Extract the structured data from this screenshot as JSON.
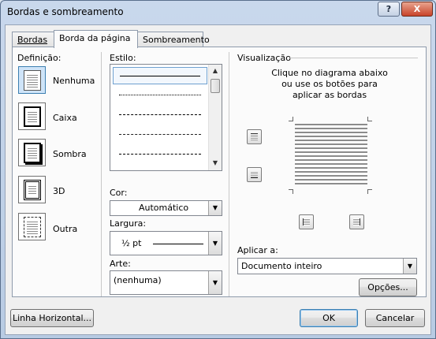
{
  "window": {
    "title": "Bordas e sombreamento",
    "help_label": "?",
    "close_label": "X"
  },
  "tabs": [
    {
      "label": "Bordas",
      "active": false
    },
    {
      "label": "Borda da página",
      "active": true
    },
    {
      "label": "Sombreamento",
      "active": false
    }
  ],
  "definition": {
    "label": "Definição:",
    "options": [
      {
        "label": "Nenhuma",
        "icon": "page-lines-icon",
        "selected": true
      },
      {
        "label": "Caixa",
        "icon": "box-border-icon",
        "selected": false
      },
      {
        "label": "Sombra",
        "icon": "shadow-border-icon",
        "selected": false
      },
      {
        "label": "3D",
        "icon": "3d-border-icon",
        "selected": false
      },
      {
        "label": "Outra",
        "icon": "custom-border-icon",
        "selected": false
      }
    ]
  },
  "style": {
    "label": "Estilo:",
    "items": [
      "solid",
      "dotted",
      "dashed-short",
      "dashed",
      "dash-dot"
    ],
    "selected_index": 0
  },
  "color": {
    "label": "Cor:",
    "value": "Automático"
  },
  "width": {
    "label": "Largura:",
    "value": "½ pt"
  },
  "art": {
    "label": "Arte:",
    "value": "(nenhuma)"
  },
  "preview": {
    "label": "Visualização",
    "instructions": "Clique no diagrama abaixo ou use os botões para aplicar as bordas",
    "buttons": [
      "top-border-icon",
      "bottom-border-icon",
      "left-border-icon",
      "right-border-icon"
    ]
  },
  "apply_to": {
    "label": "Aplicar a:",
    "value": "Documento inteiro"
  },
  "buttons": {
    "options": "Opções...",
    "horizontal_line": "Linha Horizontal...",
    "ok": "OK",
    "cancel": "Cancelar"
  },
  "colors": {
    "selection": "#cfe4f8",
    "accent_border": "#3c7fb1",
    "close": "#c8432a"
  }
}
